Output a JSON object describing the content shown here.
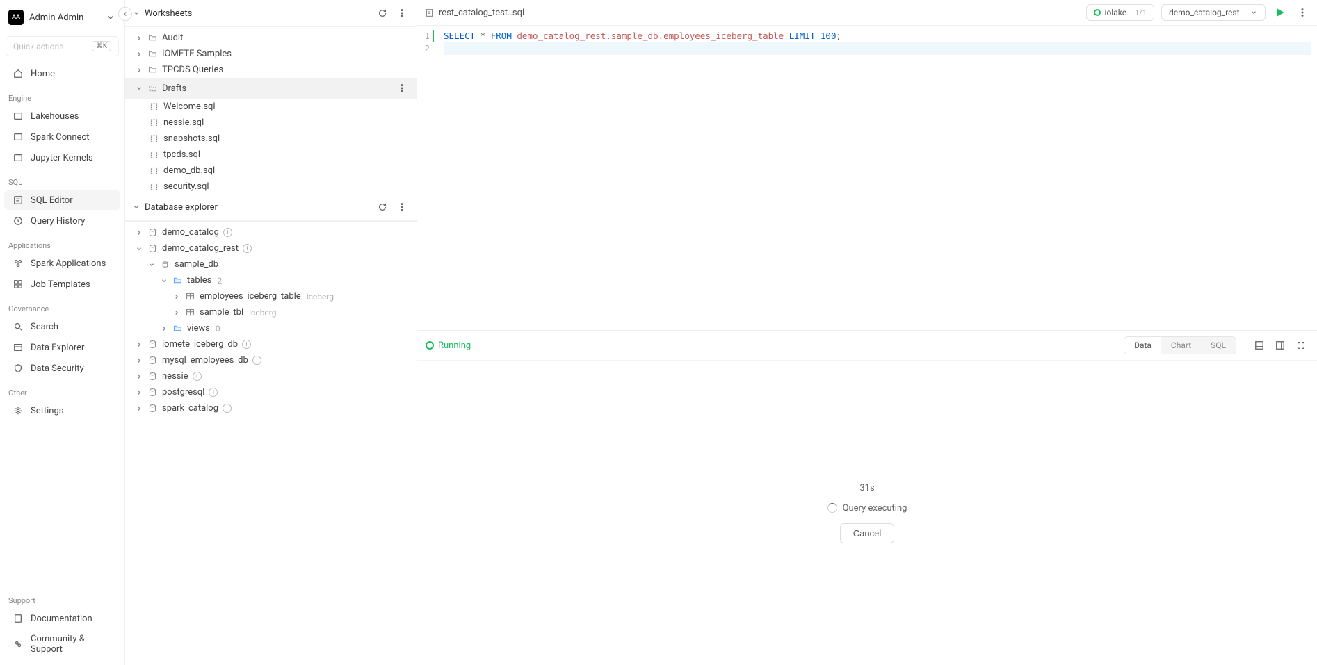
{
  "user": {
    "initials": "AA",
    "name": "Admin Admin"
  },
  "quick": {
    "placeholder": "Quick actions",
    "kbd": "⌘K"
  },
  "nav": {
    "home": "Home",
    "engine_label": "Engine",
    "lakehouses": "Lakehouses",
    "spark_connect": "Spark Connect",
    "jupyter_kernels": "Jupyter Kernels",
    "sql_label": "SQL",
    "sql_editor": "SQL Editor",
    "query_history": "Query History",
    "apps_label": "Applications",
    "spark_apps": "Spark Applications",
    "job_templates": "Job Templates",
    "gov_label": "Governance",
    "search": "Search",
    "data_explorer": "Data Explorer",
    "data_security": "Data Security",
    "other_label": "Other",
    "settings": "Settings",
    "support_label": "Support",
    "docs": "Documentation",
    "community": "Community & Support"
  },
  "worksheets": {
    "title": "Worksheets",
    "folders": {
      "audit": "Audit",
      "samples": "IOMETE Samples",
      "tpcds": "TPCDS Queries",
      "drafts": "Drafts"
    },
    "files": {
      "welcome": "Welcome.sql",
      "nessie": "nessie.sql",
      "snapshots": "snapshots.sql",
      "tpcds": "tpcds.sql",
      "demo_db": "demo_db.sql",
      "security": "security.sql"
    }
  },
  "db": {
    "title": "Database explorer",
    "catalogs": {
      "demo_catalog": "demo_catalog",
      "demo_catalog_rest": "demo_catalog_rest",
      "iomete_iceberg": "iomete_iceberg_db",
      "mysql": "mysql_employees_db",
      "nessie": "nessie",
      "postgresql": "postgresql",
      "spark_catalog": "spark_catalog"
    },
    "sample_db": "sample_db",
    "tables": "tables",
    "tables_count": "2",
    "views": "views",
    "views_count": "0",
    "emp_table": "employees_iceberg_table",
    "emp_type": "iceberg",
    "sample_tbl": "sample_tbl",
    "sample_type": "iceberg"
  },
  "editor": {
    "filename": "rest_catalog_test..sql",
    "lake": "iolake",
    "lake_count": "1/1",
    "catalog": "demo_catalog_rest",
    "sql_kw1": "SELECT",
    "sql_star": "*",
    "sql_kw2": "FROM",
    "sql_id": "demo_catalog_rest.sample_db.employees_iceberg_table",
    "sql_kw3": "LIMIT",
    "sql_num": "100",
    "ln1": "1",
    "ln2": "2"
  },
  "results": {
    "running": "Running",
    "data": "Data",
    "chart": "Chart",
    "sql": "SQL",
    "elapsed": "31s",
    "executing": "Query executing",
    "cancel": "Cancel"
  }
}
